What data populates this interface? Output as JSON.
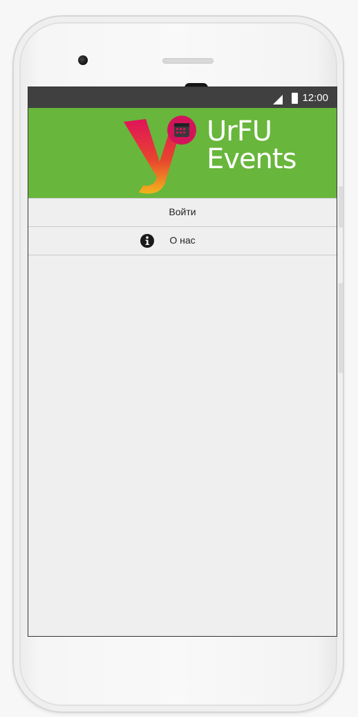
{
  "status_bar": {
    "time": "12:00"
  },
  "header": {
    "logo_line1": "UrFU",
    "logo_line2": "Events",
    "color": "#68b63c"
  },
  "menu": [
    {
      "label": "Войти",
      "icon": null
    },
    {
      "label": "О нас",
      "icon": "info-icon"
    }
  ]
}
